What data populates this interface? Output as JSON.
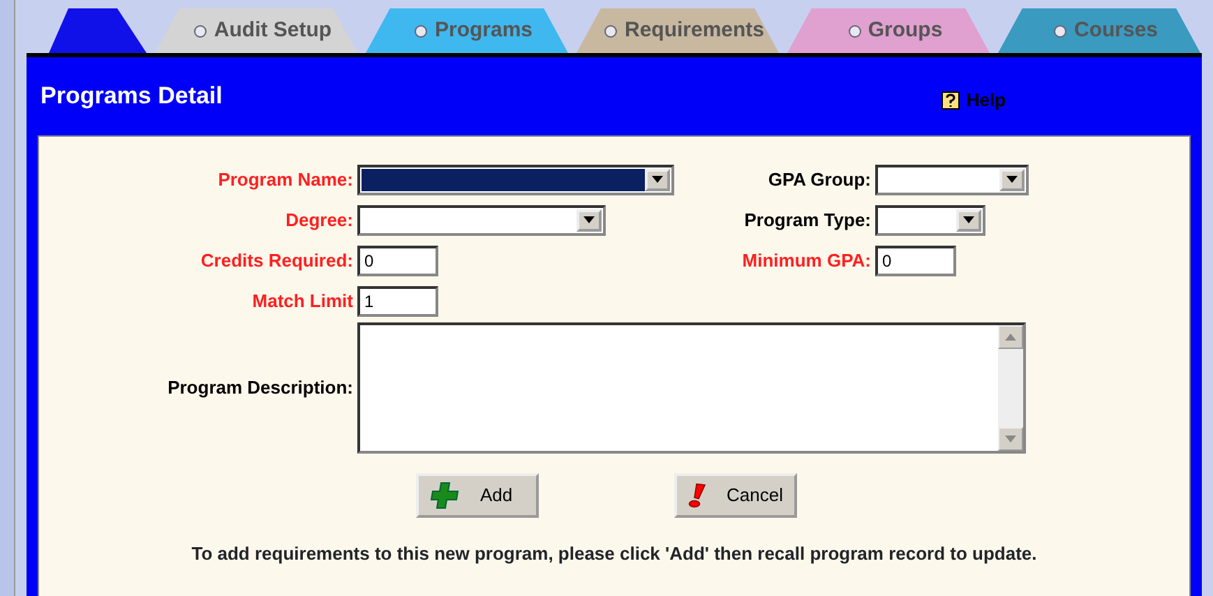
{
  "tabs": [
    {
      "label": "Audit Setup",
      "color": "#d4d4d4"
    },
    {
      "label": "Programs",
      "color": "#3fb8f0"
    },
    {
      "label": "Requirements",
      "color": "#c8b8a0"
    },
    {
      "label": "Groups",
      "color": "#e0a0d0"
    },
    {
      "label": "Courses",
      "color": "#3a9ac0"
    }
  ],
  "panel": {
    "title": "Programs Detail",
    "help": "Help"
  },
  "left_fields": [
    {
      "label": "Program Name:",
      "kind": "select",
      "required": true,
      "focused": true
    },
    {
      "label": "Degree:",
      "kind": "select",
      "required": true,
      "focused": false
    },
    {
      "label": "Credits Required:",
      "kind": "input",
      "required": true,
      "value": "0"
    },
    {
      "label": "Match Limit",
      "kind": "input",
      "required": true,
      "value": "1"
    }
  ],
  "right_fields": [
    {
      "label": "GPA Group:",
      "kind": "select",
      "required": false,
      "focused": false
    },
    {
      "label": "Program Type:",
      "kind": "select",
      "required": false,
      "focused": false
    },
    {
      "label": "Minimum GPA:",
      "kind": "input",
      "required": true,
      "value": "0"
    }
  ],
  "description": {
    "label": "Program Description:"
  },
  "buttons": [
    {
      "label": "Add",
      "kind": "add"
    },
    {
      "label": "Cancel",
      "kind": "cancel"
    }
  ],
  "note": "To add requirements to this new program, please click 'Add' then recall program record to update."
}
